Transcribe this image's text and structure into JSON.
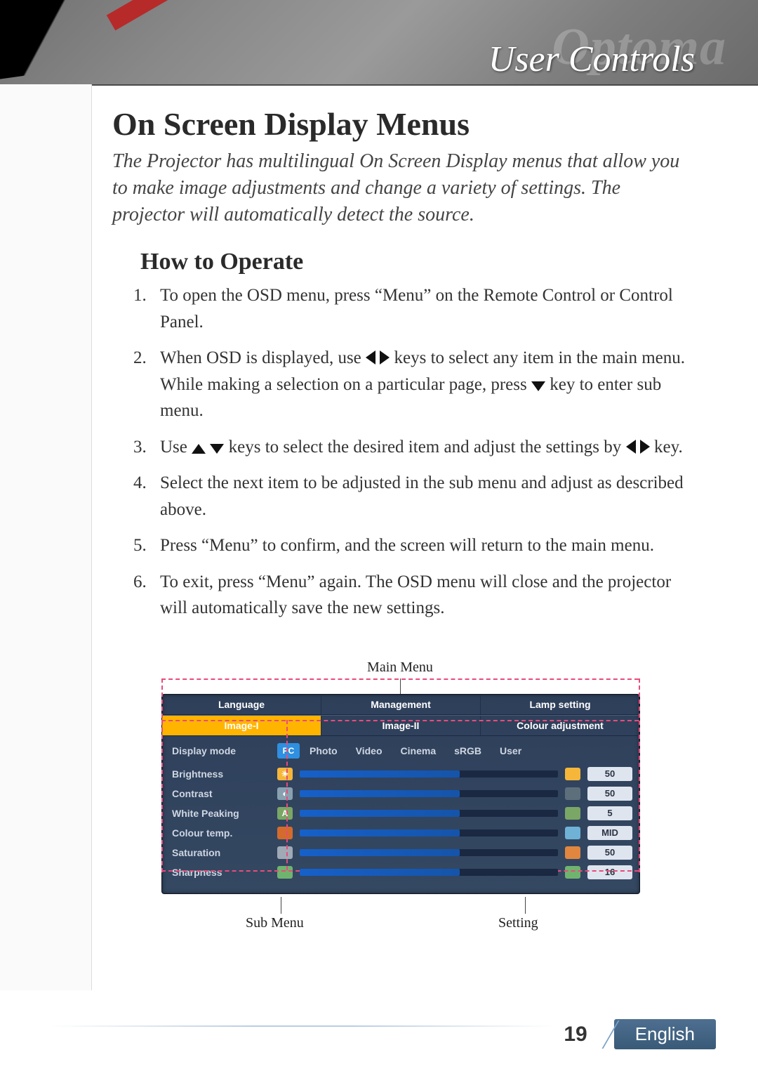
{
  "header": {
    "brand_ghost_left": "O",
    "brand_ghost_right": "ptoma",
    "chapter_title": "User Controls"
  },
  "title": "On Screen Display Menus",
  "lead": "The Projector has multilingual On Screen Display menus that allow you to make image adjustments and change a variety of settings. The projector will automatically detect the source.",
  "section_title": "How to Operate",
  "steps": {
    "s1": "To open the OSD menu, press “Menu” on the Remote Control or Control Panel.",
    "s2a": "When OSD is displayed, use ",
    "s2b": " keys to select any item in the main menu.  While making a selection on a particular page, press ",
    "s2c": " key to enter sub menu.",
    "s3a": "Use ",
    "s3b": " keys to select the desired item and adjust the settings by ",
    "s3c": " key.",
    "s4": "Select the next item to be adjusted in the sub menu and adjust as described above.",
    "s5": "Press “Menu” to confirm, and the screen will return to the main menu.",
    "s6": "To exit, press “Menu” again.  The OSD menu will close and the projector will automatically save the new settings."
  },
  "osd": {
    "main_menu_label": "Main Menu",
    "tabs_row1": {
      "a": "Language",
      "b": "Management",
      "c": "Lamp setting"
    },
    "tabs_row2": {
      "a": "Image-I",
      "b": "Image-II",
      "c": "Colour adjustment"
    },
    "display_mode": {
      "label": "Display mode",
      "selected_chip": "PC",
      "opts": {
        "o1": "Photo",
        "o2": "Video",
        "o3": "Cinema",
        "o4": "sRGB",
        "o5": "User"
      }
    },
    "rows": {
      "brightness": {
        "label": "Brightness",
        "value": "50",
        "fill_pct": 62,
        "icon_color": "#f5b63a"
      },
      "contrast": {
        "label": "Contrast",
        "value": "50",
        "fill_pct": 62,
        "icon_color": "#89a0b1"
      },
      "white_peak": {
        "label": "White Peaking",
        "value": "5",
        "fill_pct": 62,
        "icon_color": "#7aa766",
        "icon_text": "A"
      },
      "colour_temp": {
        "label": "Colour temp.",
        "value": "MID",
        "fill_pct": 62,
        "icon_color": "#d46b2d"
      },
      "saturation": {
        "label": "Saturation",
        "value": "50",
        "fill_pct": 62,
        "icon_color": "#9faab6"
      },
      "sharpness": {
        "label": "Sharpness",
        "value": "16",
        "fill_pct": 62,
        "icon_color": "#6fb36f"
      }
    },
    "sub_menu_label": "Sub Menu",
    "setting_label": "Setting"
  },
  "footer": {
    "page_number": "19",
    "language": "English"
  }
}
